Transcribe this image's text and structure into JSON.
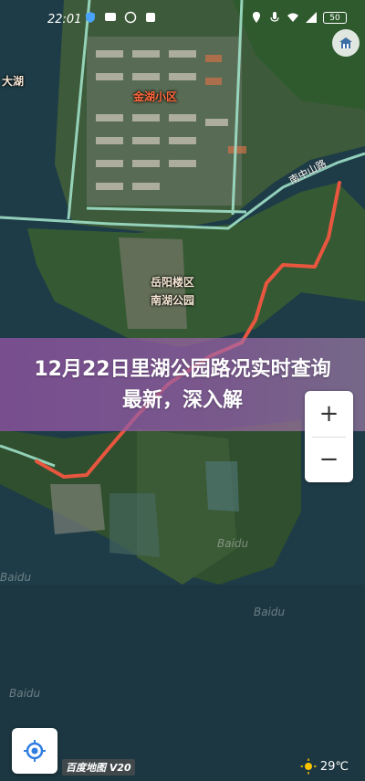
{
  "status_bar": {
    "time": "22:01",
    "battery": "50"
  },
  "map": {
    "labels": {
      "lake_west": "大湖",
      "community": "金湖小区",
      "landmark_1": "岳阳楼区",
      "landmark_2": "南湖公园",
      "road": "南中山路"
    },
    "watermarks": [
      "Baidu",
      "Baidu",
      "Baidu",
      "Baidu"
    ]
  },
  "banner": {
    "title": "12月22日里湖公园路况实时查询最新，深入解"
  },
  "controls": {
    "zoom_in": "+",
    "zoom_out": "−"
  },
  "footer": {
    "logo": "百度地图 V20",
    "temperature": "29℃"
  },
  "colors": {
    "route": "#e8563f",
    "road_outline": "#9fe0c8",
    "banner": "#8b529e"
  }
}
